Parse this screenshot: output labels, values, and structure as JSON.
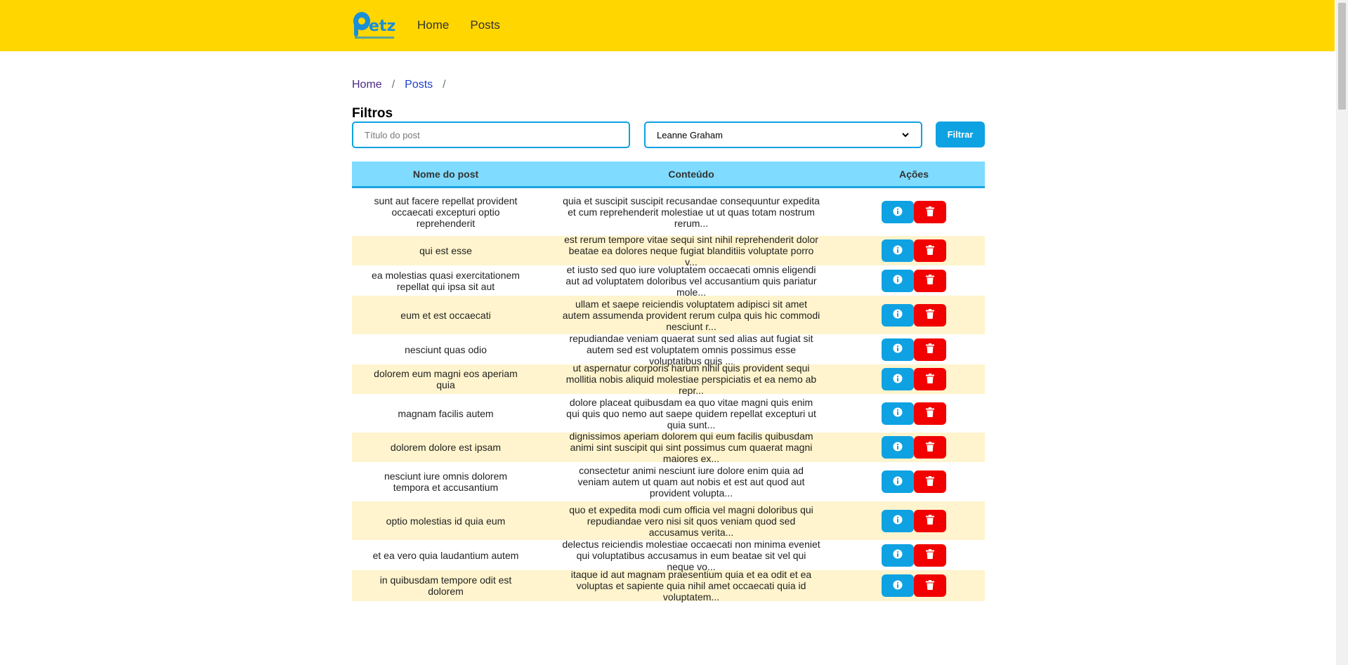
{
  "nav": {
    "logo_icon": "petz-logo-icon",
    "links": [
      "Home",
      "Posts"
    ]
  },
  "breadcrumb": {
    "home": "Home",
    "posts": "Posts",
    "separator": "/"
  },
  "filters": {
    "title": "Filtros",
    "title_placeholder": "Título do post",
    "selected_user": "Leanne Graham",
    "filter_button": "Filtrar"
  },
  "table": {
    "headers": [
      "Nome do post",
      "Conteúdo",
      "Ações"
    ],
    "rows": [
      {
        "title": "sunt aut facere repellat provident occaecati excepturi optio reprehenderit",
        "content": "quia et suscipit suscipit recusandae consequuntur expedita et cum reprehenderit molestiae ut ut quas totam nostrum rerum..."
      },
      {
        "title": "qui est esse",
        "content": "est rerum tempore vitae sequi sint nihil reprehenderit dolor beatae ea dolores neque fugiat blanditiis voluptate porro v..."
      },
      {
        "title": "ea molestias quasi exercitationem repellat qui ipsa sit aut",
        "content": "et iusto sed quo iure voluptatem occaecati omnis eligendi aut ad voluptatem doloribus vel accusantium quis pariatur mole..."
      },
      {
        "title": "eum et est occaecati",
        "content": "ullam et saepe reiciendis voluptatem adipisci sit amet autem assumenda provident rerum culpa quis hic commodi nesciunt r..."
      },
      {
        "title": "nesciunt quas odio",
        "content": "repudiandae veniam quaerat sunt sed alias aut fugiat sit autem sed est voluptatem omnis possimus esse voluptatibus quis ..."
      },
      {
        "title": "dolorem eum magni eos aperiam quia",
        "content": "ut aspernatur corporis harum nihil quis provident sequi mollitia nobis aliquid molestiae perspiciatis et ea nemo ab repr..."
      },
      {
        "title": "magnam facilis autem",
        "content": "dolore placeat quibusdam ea quo vitae magni quis enim qui quis quo nemo aut saepe quidem repellat excepturi ut quia sunt..."
      },
      {
        "title": "dolorem dolore est ipsam",
        "content": "dignissimos aperiam dolorem qui eum facilis quibusdam animi sint suscipit qui sint possimus cum quaerat magni maiores ex..."
      },
      {
        "title": "nesciunt iure omnis dolorem tempora et accusantium",
        "content": "consectetur animi nesciunt iure dolore enim quia ad veniam autem ut quam aut nobis et est aut quod aut provident volupta..."
      },
      {
        "title": "optio molestias id quia eum",
        "content": "quo et expedita modi cum officia vel magni doloribus qui repudiandae vero nisi sit quos veniam quod sed accusamus verita..."
      },
      {
        "title": "et ea vero quia laudantium autem",
        "content": "delectus reiciendis molestiae occaecati non minima eveniet qui voluptatibus accusamus in eum beatae sit vel qui neque vo..."
      },
      {
        "title": "in quibusdam tempore odit est dolorem",
        "content": "itaque id aut magnam praesentium quia et ea odit et ea voluptas et sapiente quia nihil amet occaecati quia id voluptatem..."
      }
    ]
  },
  "colors": {
    "navbar": "#ffd600",
    "accent": "#0ea2e2",
    "danger": "#f20000",
    "header_bg": "#7fdbff",
    "row_alt": "#fff4cd"
  }
}
